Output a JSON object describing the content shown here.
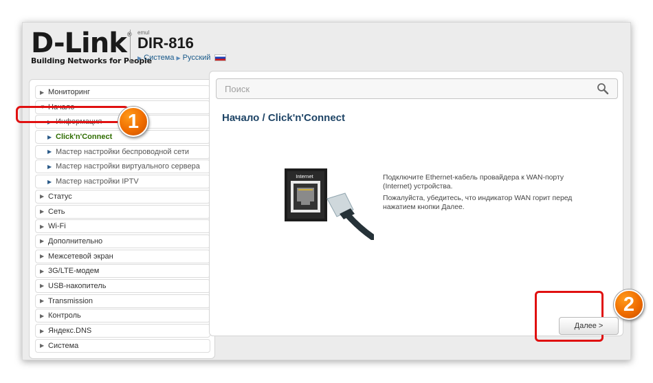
{
  "header": {
    "logo_text": "D-Link",
    "logo_tagline": "Building Networks for People",
    "logo_reg": "®",
    "emul_label": "emul",
    "model": "DIR-816",
    "breadcrumb": [
      "Система",
      "Русский"
    ],
    "flag": "russian-flag"
  },
  "sidebar": {
    "items": [
      {
        "label": "Мониторинг",
        "type": "top",
        "icon": "chevron-right-icon"
      },
      {
        "label": "Начало",
        "type": "top",
        "icon": "chevron-down-icon"
      },
      {
        "label": "Информация",
        "type": "sub",
        "icon": "chevron-right-icon"
      },
      {
        "label": "Click'n'Connect",
        "type": "sub",
        "active": true,
        "icon": "chevron-right-icon"
      },
      {
        "label": "Мастер настройки беспроводной сети",
        "type": "sub",
        "icon": "chevron-right-icon"
      },
      {
        "label": "Мастер настройки виртуального сервера",
        "type": "sub",
        "icon": "chevron-right-icon"
      },
      {
        "label": "Мастер настройки IPTV",
        "type": "sub",
        "icon": "chevron-right-icon"
      },
      {
        "label": "Статус",
        "type": "top",
        "icon": "chevron-right-icon"
      },
      {
        "label": "Сеть",
        "type": "top",
        "icon": "chevron-right-icon"
      },
      {
        "label": "Wi-Fi",
        "type": "top",
        "icon": "chevron-right-icon"
      },
      {
        "label": "Дополнительно",
        "type": "top",
        "icon": "chevron-right-icon"
      },
      {
        "label": "Межсетевой экран",
        "type": "top",
        "icon": "chevron-right-icon"
      },
      {
        "label": "3G/LTE-модем",
        "type": "top",
        "icon": "chevron-right-icon"
      },
      {
        "label": "USB-накопитель",
        "type": "top",
        "icon": "chevron-right-icon"
      },
      {
        "label": "Transmission",
        "type": "top",
        "icon": "chevron-right-icon"
      },
      {
        "label": "Контроль",
        "type": "top",
        "icon": "chevron-right-icon"
      },
      {
        "label": "Яндекс.DNS",
        "type": "top",
        "icon": "chevron-right-icon"
      },
      {
        "label": "Система",
        "type": "top",
        "icon": "chevron-right-icon"
      }
    ]
  },
  "search": {
    "placeholder": "Поиск"
  },
  "main": {
    "title": "Начало /  Click'n'Connect",
    "port_label": "Internet",
    "desc_1": "Подключите Ethernet-кабель провайдера к WAN-порту (Internet) устройства.",
    "desc_2": "Пожалуйста, убедитесь, что индикатор WAN горит перед нажатием кнопки Далее.",
    "next_label": "Далее >"
  },
  "annotations": {
    "step1": "1",
    "step2": "2"
  },
  "colors": {
    "accent_red": "#e01010",
    "callout_orange": "#ef6c00",
    "active_green": "#2f6d00",
    "title_blue": "#1e4466"
  }
}
